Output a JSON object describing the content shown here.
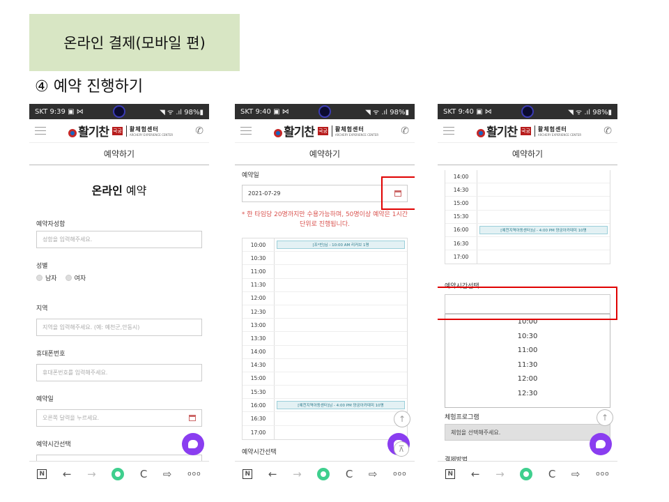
{
  "slide": {
    "title": "온라인 결제(모바일 편)",
    "step": "④ 예약 진행하기"
  },
  "common": {
    "carrier": "SKT",
    "status_icons": "◥ ᯤ .ıl",
    "logo_text": "활기찬",
    "logo_tag": "국궁",
    "logo_sub": "활체험센터",
    "logo_sub_en": "ARCHERY EXPERIENCE CENTER",
    "page_header": "예약하기",
    "bottom_nav": [
      "N",
      "←",
      "→",
      "",
      "C",
      "⇨",
      "ooo"
    ]
  },
  "phones": [
    {
      "time": "9:39",
      "battery": "98%"
    },
    {
      "time": "9:40",
      "battery": "98%"
    },
    {
      "time": "9:40",
      "battery": "98%"
    }
  ],
  "screen1": {
    "form_title_bold": "온라인",
    "form_title_rest": " 예약",
    "name_label": "예약자성함",
    "name_placeholder": "성함을 입력해주세요.",
    "gender_label": "성별",
    "gender_male": "남자",
    "gender_female": "여자",
    "region_label": "지역",
    "region_placeholder": "지역을 입력해주세요. (예: 예천군,안동시)",
    "phone_label": "휴대폰번호",
    "phone_placeholder": "휴대폰번호를 입력해주세요.",
    "date_label": "예약일",
    "date_placeholder": "오른쪽 달력을 누르세요.",
    "time_label": "예약시간선택"
  },
  "screen2": {
    "date_label": "예약일",
    "date_value": "2021-07-29",
    "notice": "* 한 타임당 20명까지만 수용가능하며, 50명이상 예약은 1시간단위로 진행됩니다.",
    "schedule": [
      {
        "time": "10:00",
        "event": "[조*빈]님 - 10:00 AM  리커브 1명"
      },
      {
        "time": "10:30",
        "event": ""
      },
      {
        "time": "11:00",
        "event": ""
      },
      {
        "time": "11:30",
        "event": ""
      },
      {
        "time": "12:00",
        "event": ""
      },
      {
        "time": "12:30",
        "event": ""
      },
      {
        "time": "13:00",
        "event": ""
      },
      {
        "time": "13:30",
        "event": ""
      },
      {
        "time": "14:00",
        "event": ""
      },
      {
        "time": "14:30",
        "event": ""
      },
      {
        "time": "15:00",
        "event": ""
      },
      {
        "time": "15:30",
        "event": ""
      },
      {
        "time": "16:00",
        "event": "[예천지역아동센터]님 - 4:00 PM  양궁아카데미 10명"
      },
      {
        "time": "16:30",
        "event": ""
      },
      {
        "time": "17:00",
        "event": ""
      }
    ],
    "next_label": "예약시간선택"
  },
  "screen3": {
    "schedule": [
      {
        "time": "14:00",
        "event": ""
      },
      {
        "time": "14:30",
        "event": ""
      },
      {
        "time": "15:00",
        "event": ""
      },
      {
        "time": "15:30",
        "event": ""
      },
      {
        "time": "16:00",
        "event": "[예천지역아동센터]님 - 4:00 PM  양궁아카데미 10명"
      },
      {
        "time": "16:30",
        "event": ""
      },
      {
        "time": "17:00",
        "event": ""
      }
    ],
    "time_label": "예약시간선택",
    "time_options": [
      "10:00",
      "10:30",
      "11:00",
      "11:30",
      "12:00",
      "12:30"
    ],
    "program_label": "체험프로그램",
    "program_placeholder": "체험을 선택해주세요.",
    "payment_label": "결제방법"
  }
}
